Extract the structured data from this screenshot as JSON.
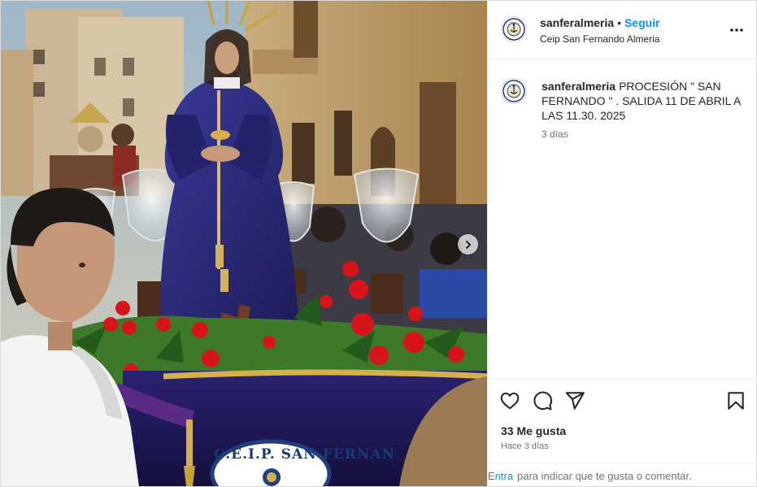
{
  "post": {
    "media": {
      "plaque_text": "C.E.I.P. SAN FERNAN",
      "next_icon": "chevron-right-icon"
    },
    "header": {
      "username": "sanferalmeria",
      "separator": "•",
      "follow_label": "Seguir",
      "location": "Ceip San Fernando Almeria",
      "more_icon": "more-horizontal-icon"
    },
    "caption": {
      "username": "sanferalmeria",
      "text": "PROCESIÓN \" SAN FERNANDO \" . SALIDA 11 DE ABRIL A LAS 11.30. 2025",
      "time": "3 días"
    },
    "actions": {
      "like_icon": "heart-icon",
      "comment_icon": "comment-icon",
      "share_icon": "send-icon",
      "save_icon": "bookmark-icon",
      "likes_text": "33 Me gusta",
      "time_ago": "Hace 3 días"
    },
    "comment_bar": {
      "enter_label": "Entra",
      "hint_text": "para indicar que te gusta o comentar."
    },
    "colors": {
      "accent": "#0095f6",
      "text": "#262626",
      "muted": "#737373",
      "robe": "#2b2a7a",
      "flowers": "#d8141b"
    }
  }
}
